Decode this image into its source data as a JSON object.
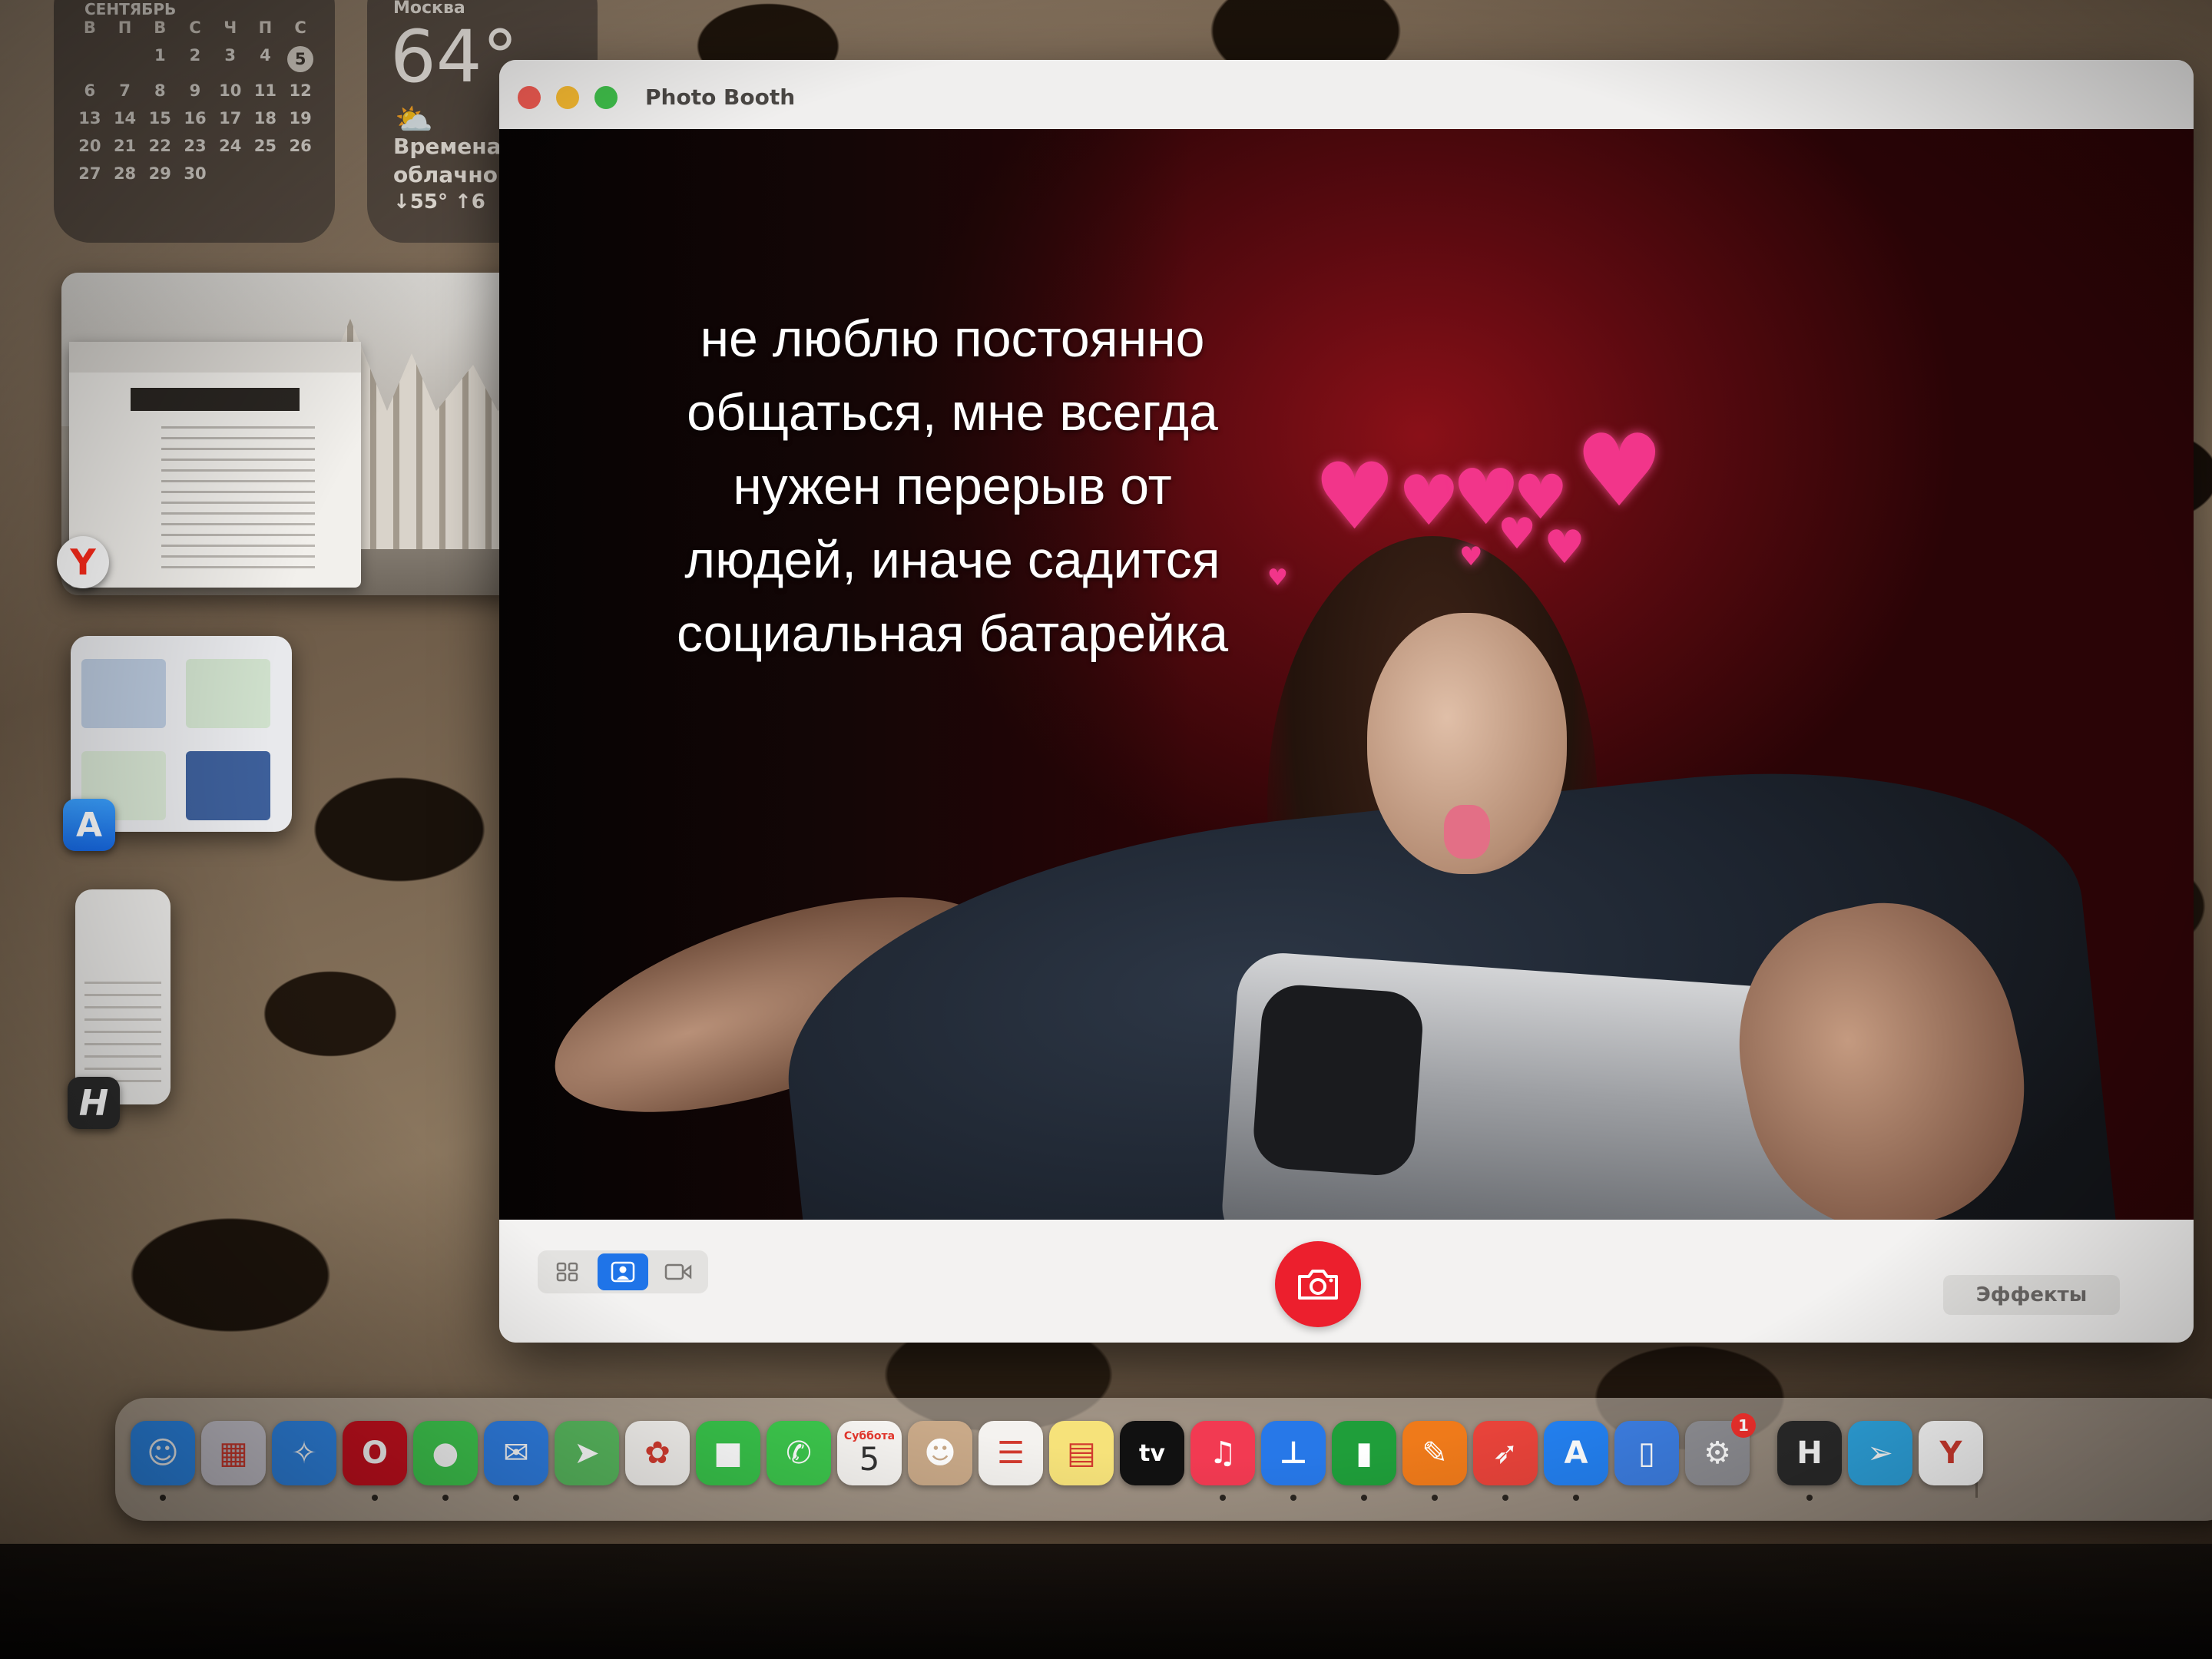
{
  "calendar": {
    "title": "СЕНТЯБРЬ",
    "weekdays": [
      "В",
      "П",
      "В",
      "С",
      "Ч",
      "П",
      "С"
    ],
    "days": [
      "",
      "",
      "1",
      "2",
      "3",
      "4",
      "5",
      "6",
      "7",
      "8",
      "9",
      "10",
      "11",
      "12",
      "13",
      "14",
      "15",
      "16",
      "17",
      "18",
      "19",
      "20",
      "21",
      "22",
      "23",
      "24",
      "25",
      "26",
      "27",
      "28",
      "29",
      "30",
      "",
      "",
      ""
    ],
    "today": "5"
  },
  "weather": {
    "city": "Москва",
    "temperature": "64°",
    "condition_line1": "Временами",
    "condition_line2": "облачно",
    "range": "↓55° ↑6"
  },
  "stage_manager": {
    "apps": [
      {
        "name": "Yandex Browser",
        "icon": "yandex-icon",
        "glyph": "Y"
      },
      {
        "name": "App Store",
        "icon": "app-store-icon",
        "glyph": "A"
      },
      {
        "name": "H",
        "icon": "h-app-icon",
        "glyph": "H"
      }
    ]
  },
  "photo_booth": {
    "title": "Photo Booth",
    "overlay_lines": [
      "не люблю постоянно",
      "общаться, мне всегда",
      "нужен перерыв от",
      "людей, иначе садится",
      "социальная батарейка"
    ],
    "effects_label": "Эффекты",
    "selected_view": "photo"
  },
  "dock": {
    "calendar_day_label": "Суббота",
    "calendar_day_number": "5",
    "tv_label": "tv",
    "settings_badge": "1",
    "apps": [
      {
        "name": "Finder",
        "icon": "finder-icon",
        "glyph": "☺",
        "color": "#2d8cf0"
      },
      {
        "name": "Launchpad",
        "icon": "launchpad-icon",
        "glyph": "▦",
        "color": "#c9c6cf"
      },
      {
        "name": "Safari",
        "icon": "safari-icon",
        "glyph": "✧",
        "color": "#2f86e6"
      },
      {
        "name": "Opera",
        "icon": "opera-icon",
        "glyph": "O",
        "color": "#c8101e"
      },
      {
        "name": "Messages",
        "icon": "messages-icon",
        "glyph": "●",
        "color": "#3fc94f"
      },
      {
        "name": "Mail",
        "icon": "mail-icon",
        "glyph": "✉",
        "color": "#2f7fe4"
      },
      {
        "name": "Maps",
        "icon": "maps-icon",
        "glyph": "➤",
        "color": "#58b85e"
      },
      {
        "name": "Photos",
        "icon": "photos-icon",
        "glyph": "✿",
        "color": "#f3f1ee"
      },
      {
        "name": "FaceTime",
        "icon": "facetime-icon",
        "glyph": "■",
        "color": "#38c24a"
      },
      {
        "name": "Phone",
        "icon": "phone-icon",
        "glyph": "✆",
        "color": "#3cc64c"
      },
      {
        "name": "Calendar",
        "icon": "calendar-icon",
        "glyph": "",
        "color": "#f7f5f2"
      },
      {
        "name": "Contacts",
        "icon": "contacts-icon",
        "glyph": "☻",
        "color": "#c9a988"
      },
      {
        "name": "Reminders",
        "icon": "reminders-icon",
        "glyph": "☰",
        "color": "#f4f2ef"
      },
      {
        "name": "Notes",
        "icon": "notes-icon",
        "glyph": "▤",
        "color": "#f6e27a"
      },
      {
        "name": "TV",
        "icon": "apple-tv-icon",
        "glyph": "",
        "color": "#111111"
      },
      {
        "name": "Music",
        "icon": "music-icon",
        "glyph": "♫",
        "color": "#f23a52"
      },
      {
        "name": "Keynote",
        "icon": "keynote-icon",
        "glyph": "⊥",
        "color": "#2778e8"
      },
      {
        "name": "Numbers",
        "icon": "numbers-icon",
        "glyph": "▮",
        "color": "#1f9e3a"
      },
      {
        "name": "Pages",
        "icon": "pages-icon",
        "glyph": "✎",
        "color": "#ef7a1a"
      },
      {
        "name": "Rocket",
        "icon": "rocket-icon",
        "glyph": "➶",
        "color": "#e8433a"
      },
      {
        "name": "App Store",
        "icon": "app-store-icon",
        "glyph": "A",
        "color": "#2380f0"
      },
      {
        "name": "iPhone Mirroring",
        "icon": "iphone-mirroring-icon",
        "glyph": "▯",
        "color": "#3c7de0"
      },
      {
        "name": "System Settings",
        "icon": "settings-icon",
        "glyph": "⚙",
        "color": "#8d8d92"
      },
      {
        "name": "H",
        "icon": "h-app-icon",
        "glyph": "H",
        "color": "#2a2a2a"
      },
      {
        "name": "Telegram",
        "icon": "telegram-icon",
        "glyph": "➢",
        "color": "#2ea5e0"
      },
      {
        "name": "Yandex",
        "icon": "yandex-icon",
        "glyph": "Y",
        "color": "#ffffff"
      }
    ]
  }
}
